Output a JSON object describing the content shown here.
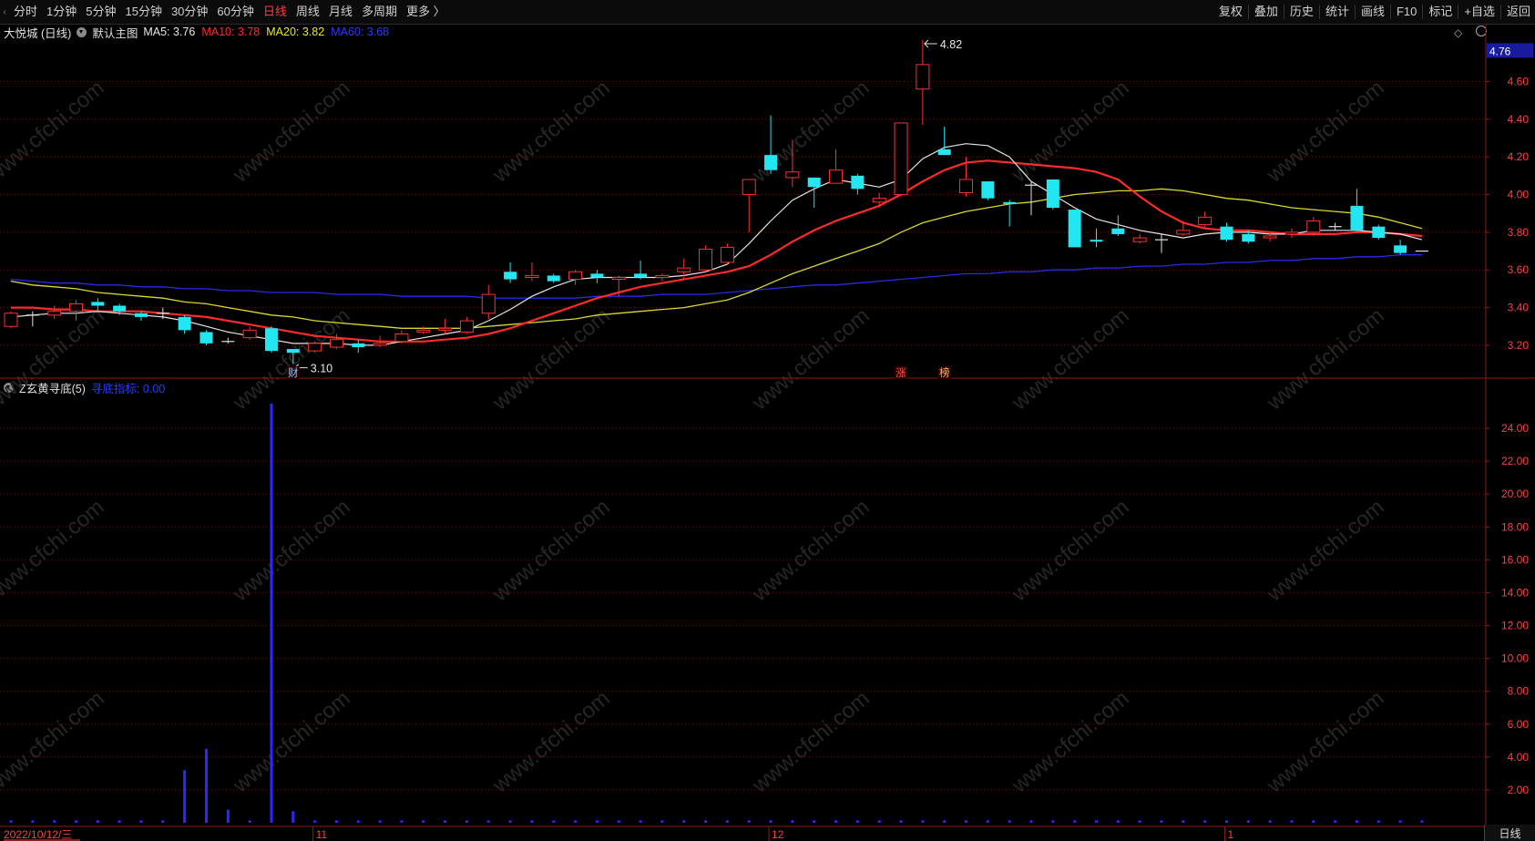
{
  "toolbar": {
    "left": [
      {
        "label": "分时",
        "active": false
      },
      {
        "label": "1分钟",
        "active": false
      },
      {
        "label": "5分钟",
        "active": false
      },
      {
        "label": "15分钟",
        "active": false
      },
      {
        "label": "30分钟",
        "active": false
      },
      {
        "label": "60分钟",
        "active": false
      },
      {
        "label": "日线",
        "active": true
      },
      {
        "label": "周线",
        "active": false
      },
      {
        "label": "月线",
        "active": false
      },
      {
        "label": "多周期",
        "active": false
      },
      {
        "label": "更多 〉",
        "active": false
      }
    ],
    "right": [
      "复权",
      "叠加",
      "历史",
      "统计",
      "画线",
      "F10",
      "标记",
      "+自选",
      "返回"
    ]
  },
  "main_panel": {
    "stock": "大悦城 (日线)",
    "theme": "默认主图",
    "ma": [
      {
        "label": "MA5: 3.76",
        "color": "#e6e6e6"
      },
      {
        "label": "MA10: 3.78",
        "color": "#ff2a2a"
      },
      {
        "label": "MA20: 3.82",
        "color": "#e8e830"
      },
      {
        "label": "MA60: 3.68",
        "color": "#2a3aff"
      }
    ],
    "price_badge": "4.76",
    "high_label": "4.82",
    "low_label": "3.10",
    "markers": [
      {
        "text": "财",
        "color": "#7fc8ff"
      },
      {
        "text": "涨",
        "color": "#ff5050"
      },
      {
        "text": "榜",
        "color": "#ffb84a"
      }
    ]
  },
  "indicator_panel": {
    "name": "Z玄黄寻底(5)",
    "value_label": "寻底指标: 0.00",
    "value_color": "#2a3aff"
  },
  "x_axis": {
    "labels": [
      "2022/10/12/三",
      "11",
      "12",
      "1"
    ]
  },
  "status_tab": "日线",
  "watermark": "www.cfchi.com",
  "chart_data": [
    {
      "type": "candlestick",
      "y_axis_ticks": [
        "4.60",
        "4.40",
        "4.20",
        "4.00",
        "3.80",
        "3.60",
        "3.40",
        "3.20"
      ],
      "ylim": [
        3.04,
        4.82
      ],
      "colors": {
        "up": "#ff3030",
        "down": "#22e6f0",
        "ma5": "#e6e6e6",
        "ma10": "#ff2a2a",
        "ma20": "#d8d830",
        "ma60": "#2a2ae6"
      },
      "candles": [
        [
          3.3,
          3.37,
          3.38,
          3.29
        ],
        [
          3.36,
          3.36,
          3.38,
          3.3
        ],
        [
          3.36,
          3.38,
          3.41,
          3.34
        ],
        [
          3.38,
          3.42,
          3.44,
          3.33
        ],
        [
          3.43,
          3.41,
          3.45,
          3.38
        ],
        [
          3.41,
          3.38,
          3.42,
          3.36
        ],
        [
          3.37,
          3.35,
          3.38,
          3.33
        ],
        [
          3.37,
          3.37,
          3.4,
          3.34
        ],
        [
          3.35,
          3.28,
          3.36,
          3.26
        ],
        [
          3.27,
          3.21,
          3.28,
          3.2
        ],
        [
          3.22,
          3.22,
          3.24,
          3.21
        ],
        [
          3.24,
          3.28,
          3.3,
          3.23
        ],
        [
          3.29,
          3.17,
          3.3,
          3.16
        ],
        [
          3.18,
          3.16,
          3.18,
          3.1
        ],
        [
          3.17,
          3.21,
          3.22,
          3.16
        ],
        [
          3.19,
          3.23,
          3.26,
          3.18
        ],
        [
          3.21,
          3.19,
          3.23,
          3.16
        ],
        [
          3.2,
          3.21,
          3.25,
          3.19
        ],
        [
          3.22,
          3.26,
          3.28,
          3.21
        ],
        [
          3.27,
          3.28,
          3.3,
          3.26
        ],
        [
          3.28,
          3.29,
          3.34,
          3.26
        ],
        [
          3.27,
          3.33,
          3.35,
          3.26
        ],
        [
          3.37,
          3.47,
          3.52,
          3.34
        ],
        [
          3.59,
          3.55,
          3.64,
          3.53
        ],
        [
          3.56,
          3.57,
          3.64,
          3.54
        ],
        [
          3.57,
          3.54,
          3.58,
          3.53
        ],
        [
          3.55,
          3.59,
          3.6,
          3.52
        ],
        [
          3.58,
          3.56,
          3.6,
          3.53
        ],
        [
          3.55,
          3.56,
          3.57,
          3.46
        ],
        [
          3.58,
          3.56,
          3.65,
          3.55
        ],
        [
          3.56,
          3.57,
          3.58,
          3.54
        ],
        [
          3.59,
          3.61,
          3.66,
          3.55
        ],
        [
          3.6,
          3.71,
          3.73,
          3.59
        ],
        [
          3.64,
          3.72,
          3.74,
          3.63
        ],
        [
          4.0,
          4.08,
          4.08,
          3.8
        ],
        [
          4.21,
          4.13,
          4.42,
          4.11
        ],
        [
          4.09,
          4.12,
          4.29,
          4.04
        ],
        [
          4.09,
          4.04,
          4.09,
          3.93
        ],
        [
          4.06,
          4.13,
          4.24,
          4.06
        ],
        [
          4.1,
          4.03,
          4.11,
          4.0
        ],
        [
          3.96,
          3.98,
          4.01,
          3.93
        ],
        [
          4.0,
          4.38,
          4.38,
          3.99
        ],
        [
          4.56,
          4.69,
          4.82,
          4.37
        ],
        [
          4.24,
          4.21,
          4.36,
          4.21
        ],
        [
          4.01,
          4.08,
          4.2,
          3.99
        ],
        [
          4.07,
          3.98,
          4.07,
          3.97
        ],
        [
          3.96,
          3.95,
          3.97,
          3.83
        ],
        [
          4.05,
          4.05,
          4.07,
          3.89
        ],
        [
          4.08,
          3.93,
          4.08,
          3.92
        ],
        [
          3.92,
          3.72,
          3.92,
          3.72
        ],
        [
          3.76,
          3.75,
          3.82,
          3.72
        ],
        [
          3.82,
          3.79,
          3.89,
          3.78
        ],
        [
          3.75,
          3.77,
          3.79,
          3.74
        ],
        [
          3.76,
          3.76,
          3.79,
          3.69
        ],
        [
          3.79,
          3.81,
          3.86,
          3.78
        ],
        [
          3.84,
          3.88,
          3.91,
          3.82
        ],
        [
          3.83,
          3.76,
          3.85,
          3.75
        ],
        [
          3.79,
          3.75,
          3.81,
          3.74
        ],
        [
          3.77,
          3.78,
          3.8,
          3.75
        ],
        [
          3.79,
          3.8,
          3.82,
          3.77
        ],
        [
          3.8,
          3.86,
          3.88,
          3.78
        ],
        [
          3.83,
          3.83,
          3.85,
          3.81
        ],
        [
          3.94,
          3.81,
          4.03,
          3.8
        ],
        [
          3.83,
          3.77,
          3.84,
          3.76
        ],
        [
          3.73,
          3.69,
          3.76,
          3.68
        ],
        [
          3.7,
          3.7,
          3.7,
          3.7
        ]
      ],
      "ma5": [
        3.35,
        3.36,
        3.37,
        3.37,
        3.38,
        3.37,
        3.36,
        3.35,
        3.33,
        3.3,
        3.27,
        3.25,
        3.23,
        3.21,
        3.21,
        3.21,
        3.2,
        3.2,
        3.22,
        3.24,
        3.26,
        3.28,
        3.33,
        3.39,
        3.46,
        3.51,
        3.55,
        3.56,
        3.56,
        3.56,
        3.56,
        3.57,
        3.59,
        3.63,
        3.74,
        3.86,
        3.97,
        4.03,
        4.08,
        4.06,
        4.04,
        4.08,
        4.19,
        4.25,
        4.27,
        4.26,
        4.2,
        4.07,
        4.0,
        3.93,
        3.87,
        3.84,
        3.81,
        3.79,
        3.77,
        3.79,
        3.8,
        3.8,
        3.79,
        3.79,
        3.81,
        3.81,
        3.81,
        3.8,
        3.79,
        3.76
      ],
      "ma10": [
        3.4,
        3.4,
        3.39,
        3.39,
        3.38,
        3.38,
        3.38,
        3.37,
        3.36,
        3.35,
        3.33,
        3.31,
        3.29,
        3.27,
        3.25,
        3.24,
        3.23,
        3.22,
        3.22,
        3.22,
        3.23,
        3.24,
        3.26,
        3.29,
        3.33,
        3.37,
        3.41,
        3.45,
        3.48,
        3.51,
        3.53,
        3.55,
        3.57,
        3.59,
        3.62,
        3.68,
        3.75,
        3.81,
        3.86,
        3.9,
        3.94,
        4.0,
        4.07,
        4.13,
        4.17,
        4.18,
        4.17,
        4.16,
        4.15,
        4.14,
        4.12,
        4.08,
        3.99,
        3.91,
        3.85,
        3.82,
        3.81,
        3.81,
        3.8,
        3.79,
        3.79,
        3.79,
        3.8,
        3.8,
        3.79,
        3.78
      ],
      "ma20": [
        3.54,
        3.52,
        3.51,
        3.5,
        3.48,
        3.47,
        3.46,
        3.45,
        3.43,
        3.42,
        3.4,
        3.38,
        3.36,
        3.35,
        3.33,
        3.32,
        3.31,
        3.3,
        3.29,
        3.29,
        3.29,
        3.29,
        3.3,
        3.31,
        3.32,
        3.33,
        3.34,
        3.36,
        3.37,
        3.38,
        3.39,
        3.4,
        3.42,
        3.44,
        3.48,
        3.53,
        3.58,
        3.62,
        3.66,
        3.7,
        3.74,
        3.8,
        3.85,
        3.88,
        3.91,
        3.93,
        3.95,
        3.96,
        3.98,
        4.0,
        4.01,
        4.02,
        4.02,
        4.03,
        4.02,
        4.0,
        3.98,
        3.97,
        3.95,
        3.93,
        3.92,
        3.91,
        3.9,
        3.88,
        3.85,
        3.82
      ],
      "ma60": [
        3.55,
        3.54,
        3.53,
        3.53,
        3.52,
        3.52,
        3.51,
        3.51,
        3.5,
        3.5,
        3.49,
        3.49,
        3.48,
        3.48,
        3.48,
        3.47,
        3.47,
        3.47,
        3.46,
        3.46,
        3.46,
        3.46,
        3.45,
        3.45,
        3.45,
        3.45,
        3.45,
        3.46,
        3.46,
        3.46,
        3.47,
        3.47,
        3.47,
        3.48,
        3.49,
        3.5,
        3.51,
        3.52,
        3.52,
        3.53,
        3.54,
        3.55,
        3.56,
        3.57,
        3.58,
        3.58,
        3.59,
        3.59,
        3.6,
        3.6,
        3.61,
        3.61,
        3.62,
        3.62,
        3.63,
        3.63,
        3.64,
        3.64,
        3.65,
        3.65,
        3.66,
        3.66,
        3.67,
        3.67,
        3.68,
        3.68
      ]
    },
    {
      "type": "bar",
      "title": "Z玄黄寻底(5)",
      "y_axis_ticks": [
        "24.00",
        "22.00",
        "20.00",
        "18.00",
        "16.00",
        "14.00",
        "12.00",
        "10.00",
        "8.00",
        "6.00",
        "4.00",
        "2.00"
      ],
      "ylim": [
        0,
        26
      ],
      "color": "#2a2aff",
      "values": [
        0,
        0,
        0,
        0,
        0,
        0,
        0,
        0,
        3.2,
        4.5,
        0.8,
        0,
        25.5,
        0.7,
        0,
        0,
        0,
        0,
        0,
        0,
        0,
        0,
        0,
        0,
        0,
        0,
        0,
        0,
        0,
        0,
        0,
        0,
        0,
        0,
        0,
        0,
        0,
        0,
        0,
        0,
        0,
        0,
        0,
        0,
        0,
        0,
        0,
        0,
        0,
        0,
        0,
        0,
        0,
        0,
        0,
        0,
        0,
        0,
        0,
        0,
        0,
        0,
        0,
        0,
        0,
        0
      ]
    }
  ]
}
